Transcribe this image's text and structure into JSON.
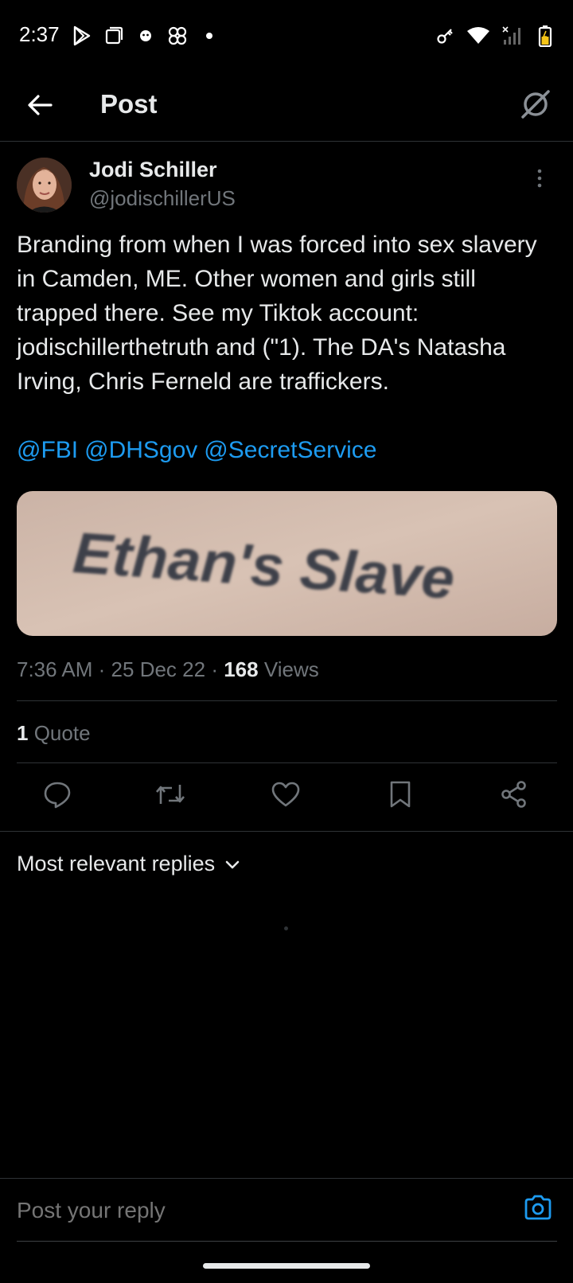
{
  "status_bar": {
    "time": "2:37",
    "left_icons": [
      "play-store-icon",
      "screenshot-icon",
      "notification-icon",
      "pinwheel-icon",
      "dot-icon"
    ],
    "right_icons": [
      "vpn-key-icon",
      "wifi-icon",
      "signal-icon",
      "battery-icon"
    ]
  },
  "header": {
    "title": "Post"
  },
  "post": {
    "author_name": "Jodi Schiller",
    "author_handle": "@jodischillerUS",
    "text": "Branding from when I was forced into sex slavery in Camden, ME. Other women and girls still trapped there. See my Tiktok account: jodischillerthetruth and (\"1). The DA's Natasha Irving, Chris Ferneld are traffickers.",
    "mentions": [
      "@FBI",
      "@DHSgov",
      "@SecretService"
    ],
    "image_text": "Ethan's Slave",
    "time": "7:36 AM",
    "date": "25 Dec 22",
    "separator": "·",
    "views_count": "168",
    "views_label": "Views",
    "quote_count": "1",
    "quote_label": "Quote"
  },
  "actions": [
    "reply-icon",
    "repost-icon",
    "like-icon",
    "bookmark-icon",
    "share-icon"
  ],
  "replies": {
    "sort_label": "Most relevant replies"
  },
  "reply_bar": {
    "placeholder": "Post your reply"
  },
  "colors": {
    "background": "#000000",
    "text": "#e7e9ea",
    "secondary": "#71767b",
    "accent": "#1d9bf0",
    "divider": "#2f3336"
  }
}
